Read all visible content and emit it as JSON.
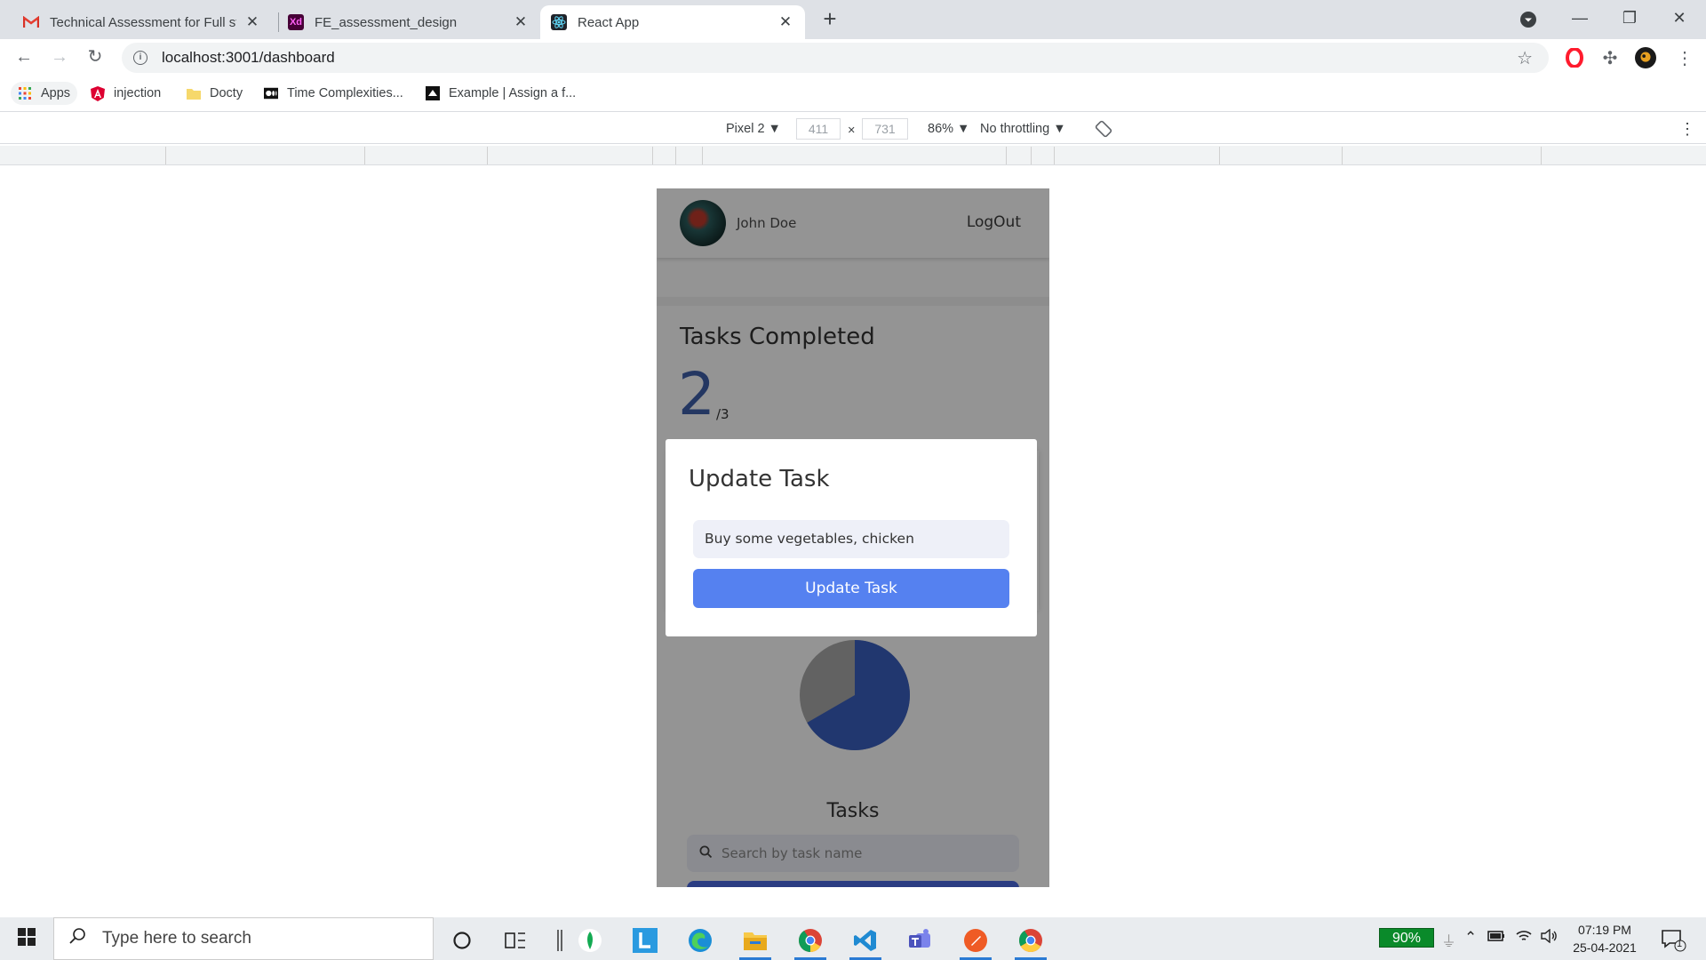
{
  "browser": {
    "tabs": [
      {
        "title": "Technical Assessment for Full stac",
        "icon": "gmail-icon",
        "active": false
      },
      {
        "title": "FE_assessment_design",
        "icon": "xd-icon",
        "active": false
      },
      {
        "title": "React App",
        "icon": "react-icon",
        "active": true
      }
    ],
    "new_tab_symbol": "+",
    "url": "localhost:3001/dashboard",
    "bookmarks": [
      {
        "label": "Apps",
        "icon": "apps-grid-icon"
      },
      {
        "label": "injection",
        "icon": "angular-icon"
      },
      {
        "label": "Docty",
        "icon": "folder-icon"
      },
      {
        "label": "Time Complexities...",
        "icon": "medium-icon"
      },
      {
        "label": "Example | Assign a f...",
        "icon": "bookmark-page-icon"
      }
    ]
  },
  "devtools": {
    "device": "Pixel 2 ▼",
    "width": "411",
    "times": "×",
    "height": "731",
    "zoom": "86% ▼",
    "throttling": "No throttling ▼"
  },
  "app": {
    "user_name": "John Doe",
    "logout_label": "LogOut",
    "tasks_completed_title": "Tasks Completed",
    "completed_count": "2",
    "total_count": "/3",
    "pie": {
      "completed": 2,
      "total": 3,
      "completed_color": "#3a5fbf",
      "remaining_color": "#a9a9a9"
    },
    "tasks_title": "Tasks",
    "search_placeholder": "Search by task name",
    "modal": {
      "title": "Update Task",
      "input_value": "Buy some vegetables, chicken",
      "button_label": "Update Task"
    }
  },
  "taskbar": {
    "search_placeholder": "Type here to search",
    "battery": "90%",
    "time": "07:19 PM",
    "date": "25-04-2021",
    "notification_count": "1"
  }
}
